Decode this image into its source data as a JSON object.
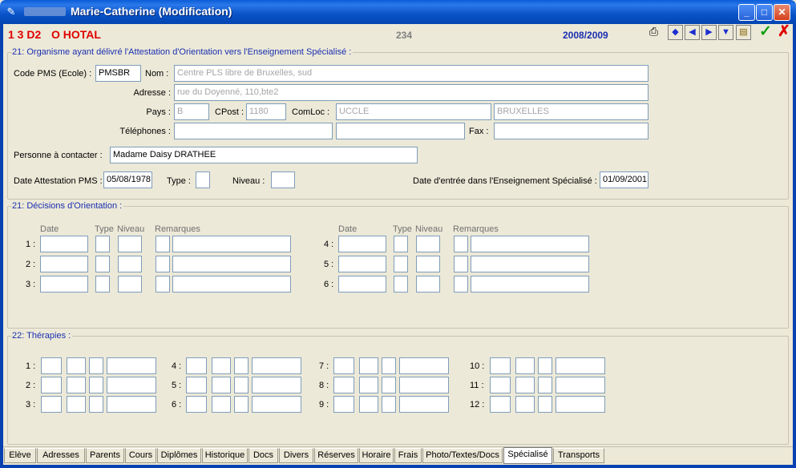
{
  "window": {
    "title": "Marie-Catherine (Modification)",
    "controls": {
      "minimize": "_",
      "maximize": "□",
      "close": "✕"
    }
  },
  "infobar": {
    "class_code": "1 3 D2",
    "name": "O HOTAL",
    "number": "234",
    "year": "2008/2009",
    "ok": "✓",
    "cancel": "✗"
  },
  "pms": {
    "title": "21: Organisme ayant délivré l'Attestation d'Orientation vers l'Enseignement Spécialisé :",
    "code_label": "Code PMS (Ecole) :",
    "code_value": "PMSBR",
    "nom_label": "Nom :",
    "nom_value": "Centre PLS libre de Bruxelles, sud",
    "adresse_label": "Adresse :",
    "adresse_value": "rue du Doyenné, 110,bte2",
    "pays_label": "Pays :",
    "pays_value": "B",
    "cpost_label": "CPost :",
    "cpost_value": "1180",
    "comloc_label": "ComLoc :",
    "comloc_value": "UCCLE",
    "ville_value": "BRUXELLES",
    "tel_label": "Téléphones :",
    "tel1_value": "",
    "tel2_value": "",
    "fax_label": "Fax :",
    "fax_value": "",
    "contact_label": "Personne à contacter :",
    "contact_value": "Madame Daisy DRATHEE",
    "date_att_label": "Date Attestation PMS :",
    "date_att_value": "05/08/1978",
    "type_label": "Type :",
    "type_value": "",
    "niveau_label": "Niveau :",
    "niveau_value": "",
    "date_entree_label": "Date d'entrée dans l'Enseignement Spécialisé :",
    "date_entree_value": "01/09/2001"
  },
  "decisions": {
    "title": "21: Décisions d'Orientation :",
    "headers": {
      "date": "Date",
      "type": "Type",
      "niveau": "Niveau",
      "remarques": "Remarques"
    },
    "rows": [
      "1 :",
      "2 :",
      "3 :",
      "4 :",
      "5 :",
      "6 :"
    ]
  },
  "therapies": {
    "title": "22: Thérapies :",
    "rows": [
      "1 :",
      "2 :",
      "3 :",
      "4 :",
      "5 :",
      "6 :",
      "7 :",
      "8 :",
      "9 :",
      "10 :",
      "11 :",
      "12 :"
    ]
  },
  "tabs": [
    "Elève",
    "Adresses",
    "Parents",
    "Cours",
    "Diplômes",
    "Historique",
    "Docs",
    "Divers",
    "Réserves",
    "Horaire",
    "Frais",
    "Photo/Textes/Docs",
    "Spécialisé",
    "Transports"
  ],
  "active_tab": "Spécialisé"
}
